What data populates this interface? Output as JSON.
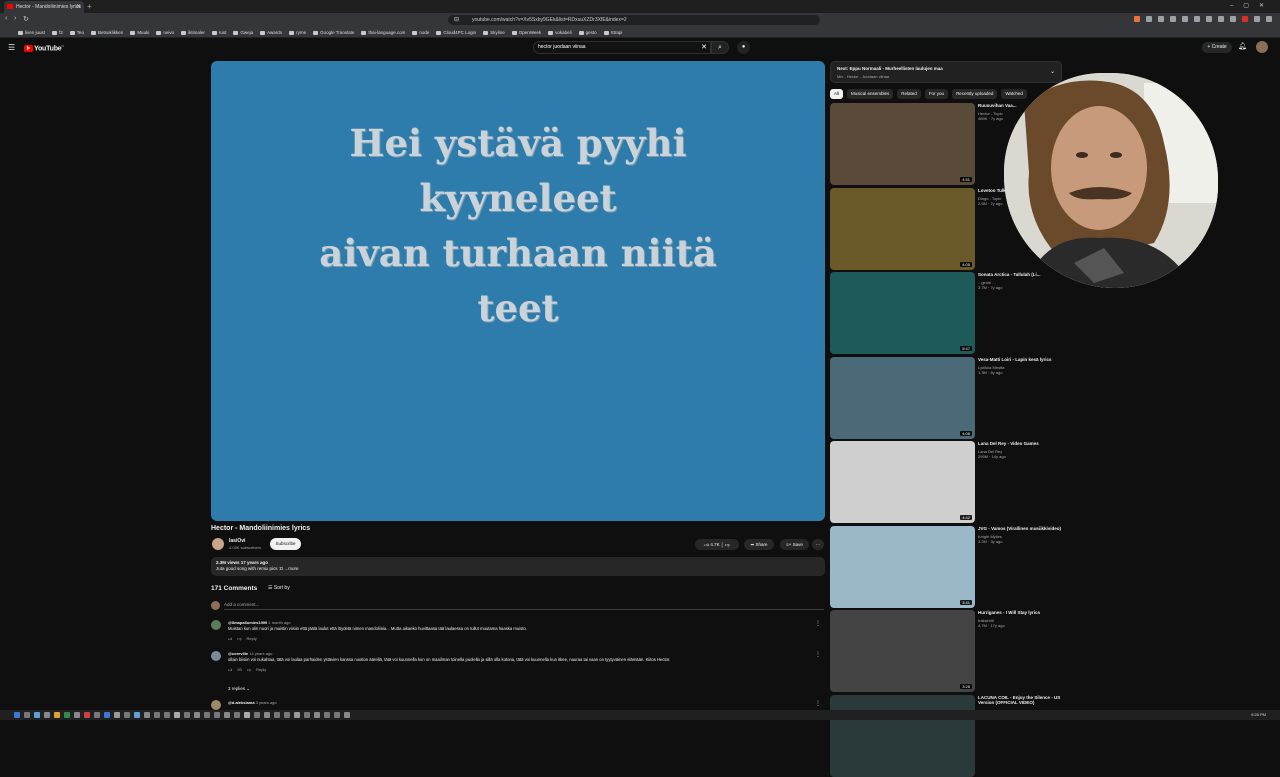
{
  "browser": {
    "tab_title": "Hector - Mandoliinimies lyrics",
    "url": "youtube.com/watch?v=Xv5Sxby9GEk&list=RDxuuXZDr3XfE&index=2",
    "bookmarks": [
      "liven juust",
      "f3",
      "Teo",
      "Betsoklikkeri",
      "Muuki",
      "neivo",
      "iktimaler",
      "rust",
      "Gweja",
      "Awards",
      "ryme",
      "Google Translate",
      "thai-language.com",
      "node",
      "Cloud4PC Login",
      "Skyline",
      "OpenWeek",
      "vokabeli",
      "gesto",
      "Strapi"
    ]
  },
  "youtube": {
    "logo": "YouTube",
    "logo_region": "FI",
    "search_value": "hector juodaan viinaa",
    "create_label": "Create"
  },
  "video": {
    "lyrics": [
      "Hei ystävä pyyhi",
      "kyyneleet",
      "aivan turhaan niitä",
      "teet"
    ],
    "title": "Hector - Mandoliinimies lyrics",
    "channel": "lasiOvi",
    "subscribers": "4.03K subscribers",
    "subscribe_label": "Subscribe",
    "likes": "4.7K",
    "share_label": "Share",
    "save_label": "Save",
    "meta": "2.3M views  17 years ago",
    "description": "Juta good song with remix pics :D ...more"
  },
  "comments": {
    "count_label": "171 Comments",
    "sort_label": "Sort by",
    "add_placeholder": "Add a comment...",
    "items": [
      {
        "author": "@ilmapallomies1999",
        "time": "1 month ago",
        "text": "Muistan kun olin nuori ja muistin viisiin että jäätä laulut että löydetä nimen mandoliinia... Mutta aikaeko huvittaasa tää laulaessa on tullut muutama haaska muisto.",
        "likes": "",
        "reply": "Reply"
      },
      {
        "author": "@coreville",
        "time": "14 years ago",
        "text": "ollain biisiin voi nukahtaa, tätä voi laulaa parhaiden ystävien kanssa nuotion äärellä, tätä voi kuunnella kun on maailman toinella puolella ja sillä olla kotona, tätä voi kuunnella kun itkee, nauraa tai vaan on tyytyväinen elämään. Kiitos Hector.",
        "likes": "93",
        "reply": "Reply"
      },
      {
        "author": "@d.aleksiama",
        "time": "3 years ago",
        "text": "",
        "likes": "",
        "reply": ""
      }
    ],
    "replies_label": "3 replies"
  },
  "sidebar": {
    "next_title": "Next: Eppu Normaali - Murheellisten laulujen maa",
    "next_sub": "Mix - Hector - Juodaan viinaa",
    "chips": [
      "All",
      "Musical ensembles",
      "Related",
      "For you",
      "Recently uploaded",
      "Watched"
    ],
    "items": [
      {
        "title": "Ruusuvihan Vaa...",
        "channel": "Hector - Topic",
        "views": "489K · 7y ago",
        "duration": "4:51",
        "color": "#5a4a3a"
      },
      {
        "title": "Lovetoo Tulk...",
        "channel": "Dingo - Topic",
        "views": "2.5M · 7y ago",
        "duration": "4:05",
        "color": "#6a5a2a"
      },
      {
        "title": "Sonata Arctica - Tallulah (Li...",
        "channel": "...genie ...",
        "views": "3.7M · 7y ago",
        "duration": "5:47",
        "color": "#1f5a5a"
      },
      {
        "title": "Vesa-Matti Loiri - Lapin kesä lyrics",
        "channel": "Lyriikka Mestta",
        "views": "1.3M · 8y ago",
        "duration": "4:08",
        "color": "#4a6a78"
      },
      {
        "title": "Lana Del Rey - Video Games",
        "channel": "Lana Del Rey",
        "views": "295M · 14y ago",
        "duration": "4:42",
        "color": "#cfcfcf"
      },
      {
        "title": "JVG - Vamos (Virallinen musiikkivideo)",
        "channel": "Knight Mylies",
        "views": "3.2M · 3y ago",
        "duration": "3:41",
        "color": "#9bb8c8"
      },
      {
        "title": "Hurriganes - I Will Stay lyrics",
        "channel": "traksimiti",
        "views": "4.7M · 17y ago",
        "duration": "3:28",
        "color": "#444444"
      },
      {
        "title": "LACUNA COIL - Enjoy the Silence - US Version (OFFICIAL VIDEO)",
        "channel": "",
        "views": "",
        "duration": "",
        "color": "#2a3a3a"
      }
    ]
  },
  "taskbar": {
    "clock": "9:28 PM"
  }
}
